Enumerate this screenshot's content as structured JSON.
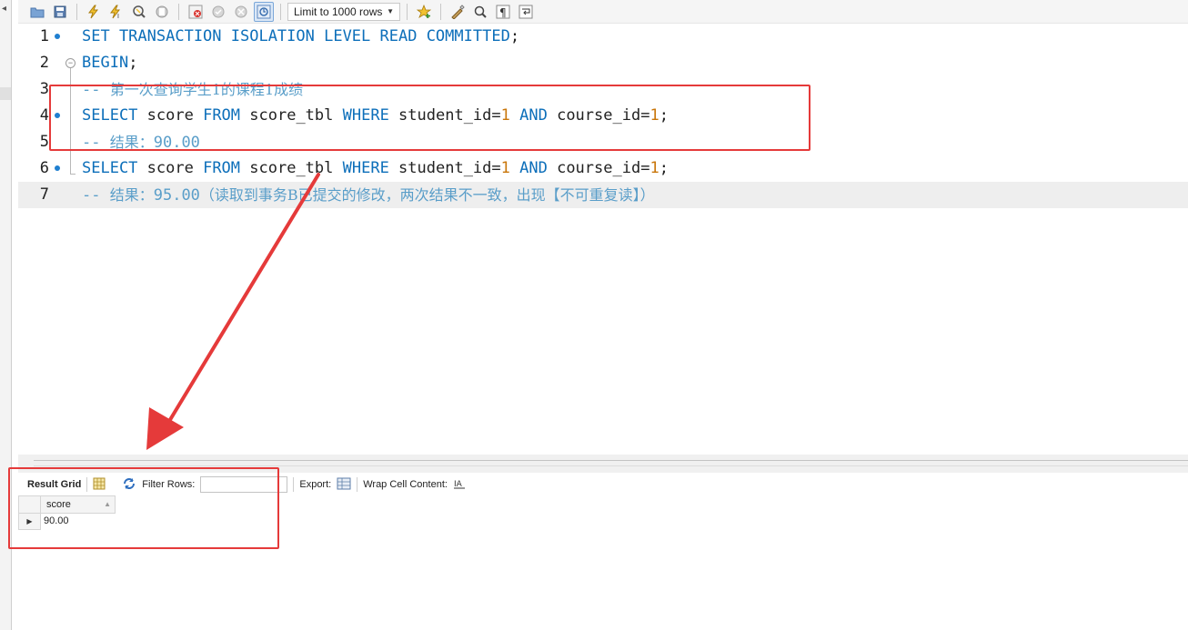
{
  "toolbar": {
    "limit_select_value": "Limit to 1000 rows"
  },
  "editor": {
    "lines": [
      {
        "num": "1",
        "tokens": [
          [
            "kw",
            "SET TRANSACTION ISOLATION LEVEL READ COMMITTED"
          ],
          [
            "",
            "; "
          ]
        ]
      },
      {
        "num": "2",
        "tokens": [
          [
            "kw",
            "BEGIN"
          ],
          [
            "",
            ";"
          ]
        ]
      },
      {
        "num": "3",
        "tokens": [
          [
            "cmt",
            "-- "
          ],
          [
            "cmt cjk",
            "第一次查询学生1的课程1成绩"
          ]
        ]
      },
      {
        "num": "4",
        "tokens": [
          [
            "kw",
            "SELECT"
          ],
          [
            "",
            " score "
          ],
          [
            "kw",
            "FROM"
          ],
          [
            "",
            " score_tbl "
          ],
          [
            "kw",
            "WHERE"
          ],
          [
            "",
            " student_id="
          ],
          [
            "num",
            "1"
          ],
          [
            "kw",
            " AND"
          ],
          [
            "",
            " course_id="
          ],
          [
            "num",
            "1"
          ],
          [
            "",
            ";"
          ]
        ]
      },
      {
        "num": "5",
        "tokens": [
          [
            "cmt",
            "-- "
          ],
          [
            "cmt cjk",
            "结果："
          ],
          [
            "cmt",
            "90.00"
          ]
        ]
      },
      {
        "num": "6",
        "tokens": [
          [
            "kw",
            "SELECT"
          ],
          [
            "",
            " score "
          ],
          [
            "kw",
            "FROM"
          ],
          [
            "",
            " score_tbl "
          ],
          [
            "kw",
            "WHERE"
          ],
          [
            "",
            " student_id="
          ],
          [
            "num",
            "1"
          ],
          [
            "kw",
            " AND"
          ],
          [
            "",
            " course_id="
          ],
          [
            "num",
            "1"
          ],
          [
            "",
            ";"
          ]
        ]
      },
      {
        "num": "7",
        "tokens": [
          [
            "cmt",
            "-- "
          ],
          [
            "cmt cjk",
            "结果："
          ],
          [
            "cmt",
            "95.00"
          ],
          [
            "cmt cjk",
            "（读取到事务B已提交的修改，两次结果不一致，出现【不可重复读】）"
          ]
        ]
      }
    ]
  },
  "result_toolbar": {
    "result_grid_label": "Result Grid",
    "filter_label": "Filter Rows:",
    "export_label": "Export:",
    "wrap_label": "Wrap Cell Content:"
  },
  "result_grid": {
    "column": "score",
    "value": "90.00"
  },
  "colors": {
    "keyword": "#0d6fba",
    "number": "#c9760a",
    "comment": "#5a9ec9",
    "annotation": "#e53a3a"
  }
}
